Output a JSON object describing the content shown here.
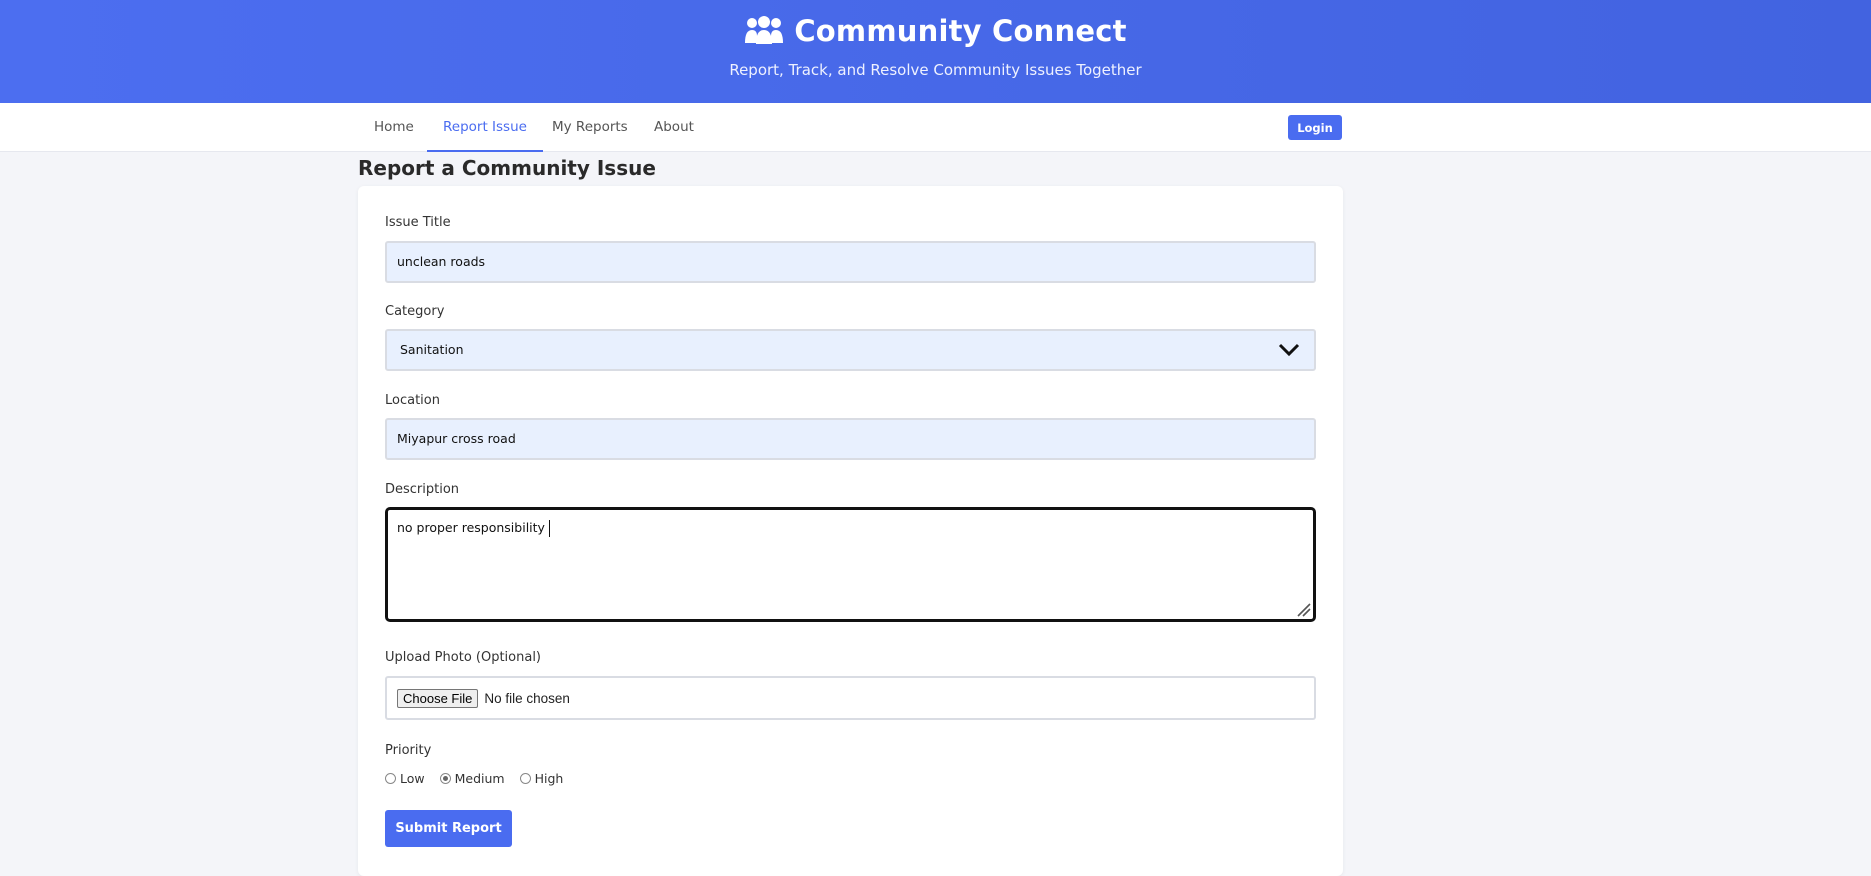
{
  "header": {
    "title": "Community Connect",
    "subtitle": "Report, Track, and Resolve Community Issues Together",
    "icon": "people-group-icon"
  },
  "nav": {
    "items": [
      "Home",
      "Report Issue",
      "My Reports",
      "About"
    ],
    "active": "Report Issue",
    "login_label": "Login"
  },
  "page": {
    "title": "Report a Community Issue"
  },
  "form": {
    "issue_title": {
      "label": "Issue Title",
      "value": "unclean roads"
    },
    "category": {
      "label": "Category",
      "value": "Sanitation"
    },
    "location": {
      "label": "Location",
      "value": "Miyapur cross road"
    },
    "description": {
      "label": "Description",
      "value": "no proper responsibility"
    },
    "photo": {
      "label": "Upload Photo (Optional)",
      "button": "Choose File",
      "status": "No file chosen"
    },
    "priority": {
      "label": "Priority",
      "options": [
        "Low",
        "Medium",
        "High"
      ],
      "selected": "Medium"
    },
    "submit_label": "Submit Report"
  },
  "colors": {
    "accent": "#4a6cf0",
    "header_bg": "#4c6ef0",
    "field_bg": "#e8f0fe"
  }
}
